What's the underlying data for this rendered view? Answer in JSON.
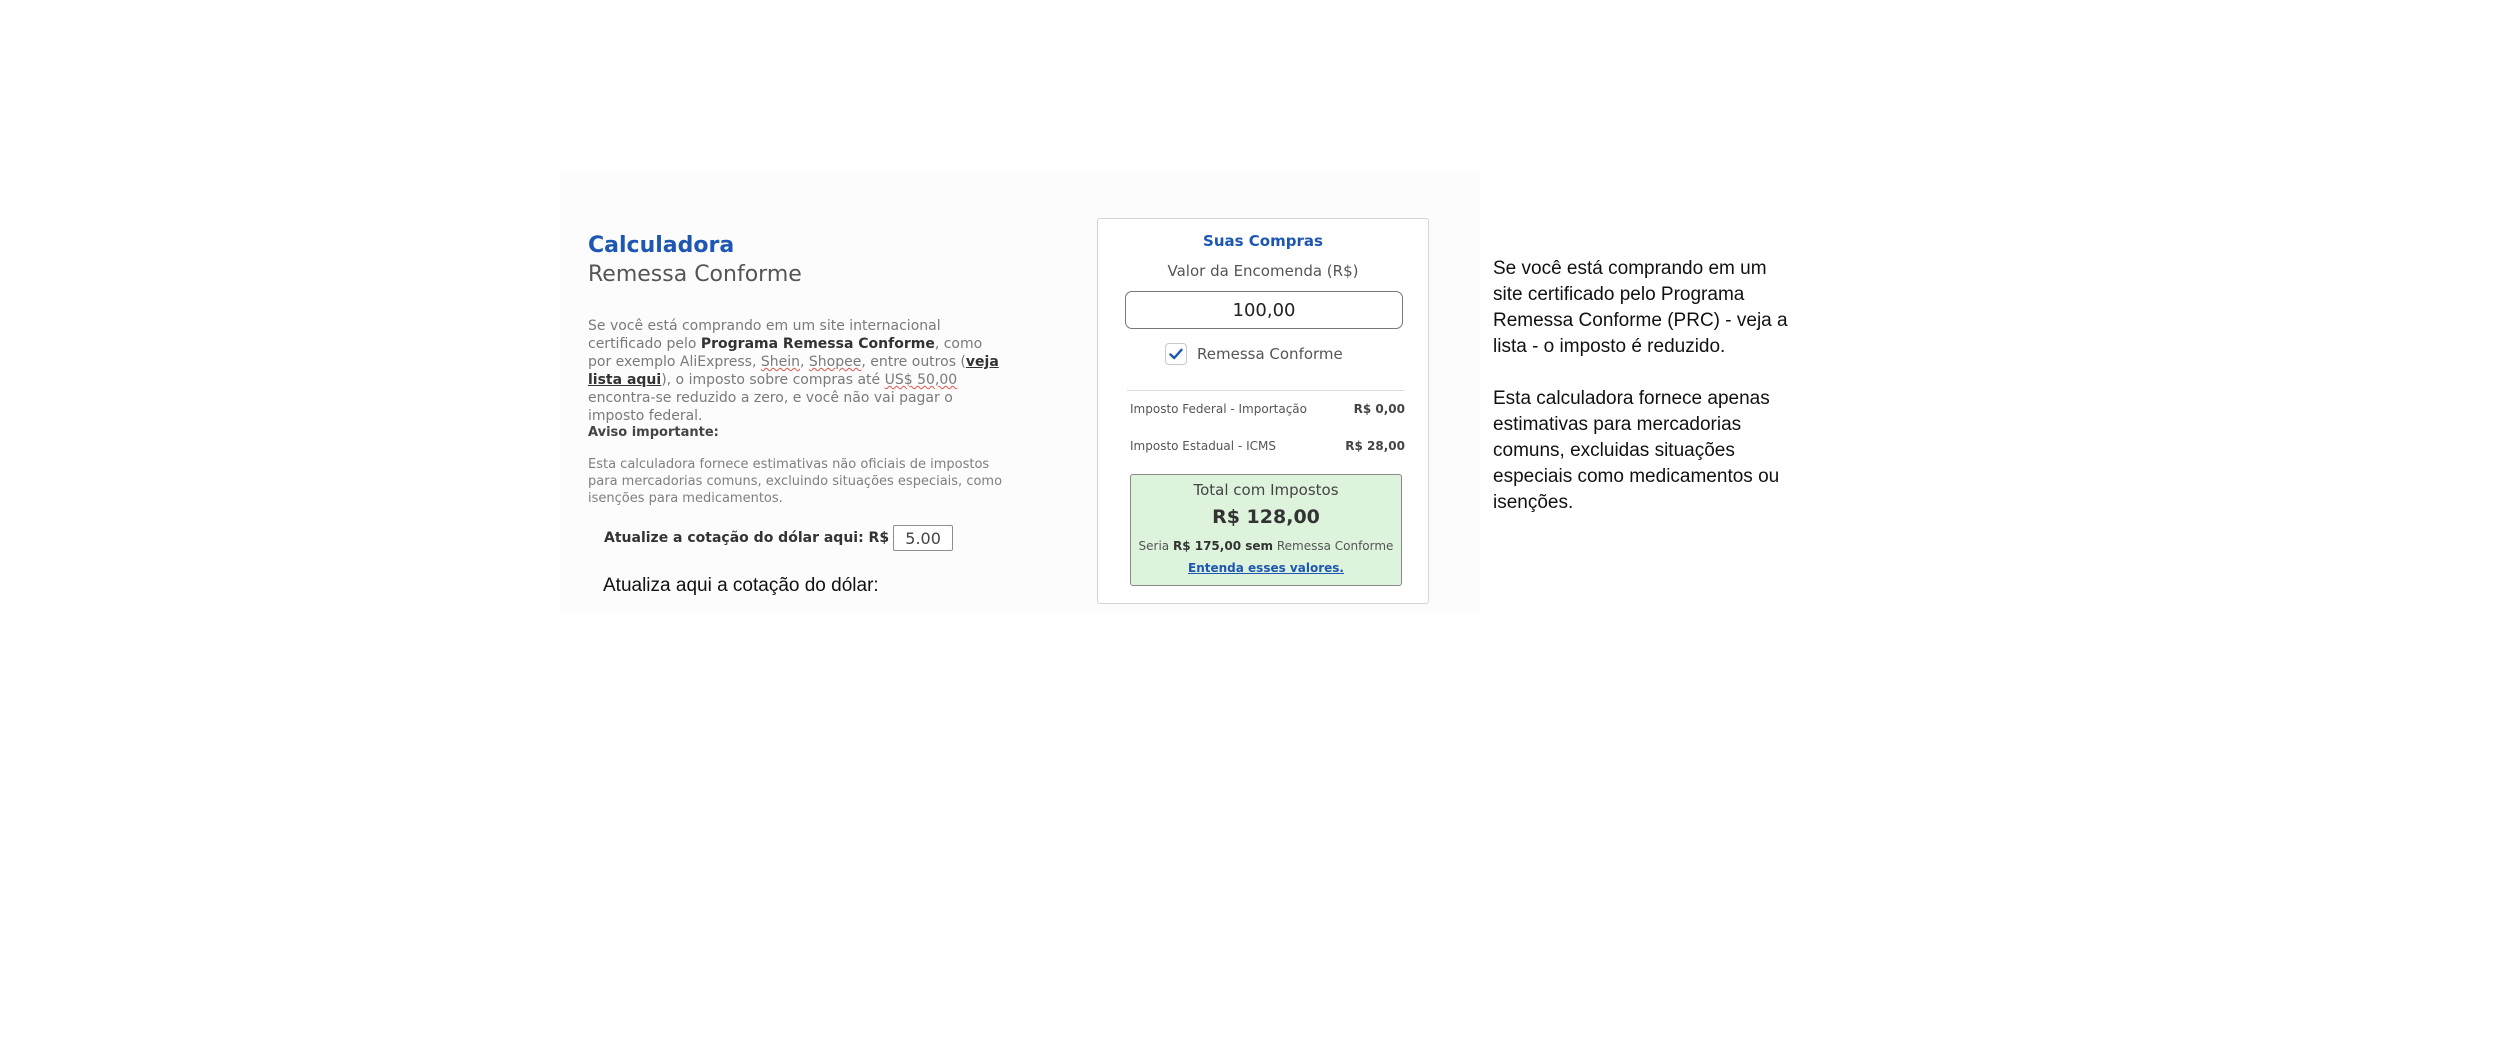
{
  "left": {
    "title": "Calculadora",
    "subtitle": "Remessa Conforme",
    "intro": {
      "p1": "Se você está comprando em um site internacional certificado pelo ",
      "program_bold": "Programa Remessa Conforme",
      "p2": ", como por exemplo AliExpress, ",
      "shein": "Shein",
      "sep1": ", ",
      "shopee": "Shopee",
      "p3": ", entre outros (",
      "link": "veja lista aqui",
      "p4": "), o imposto sobre compras até ",
      "usd": "US$ 50,00",
      "p5": " encontra-se reduzido a zero, e você não vai pagar o imposto federal."
    },
    "notice_heading": "Aviso importante:",
    "notice_text": "Esta calculadora fornece estimativas não oficiais de impostos para mercadorias comuns, excluindo situações especiais, como isenções para medicamentos.",
    "rate_label": "Atualize a cotação do dólar aqui: R$",
    "rate_value": "5.00",
    "rate_caption": "Atualiza aqui a cotação do dólar:"
  },
  "card": {
    "title": "Suas Compras",
    "value_label": "Valor da Encomenda (R$)",
    "value": "100,00",
    "checkbox_label": "Remessa Conforme",
    "checkbox_checked": true,
    "taxes": [
      {
        "label": "Imposto Federal - Importação",
        "value": "R$ 0,00"
      },
      {
        "label": "Imposto Estadual - ICMS",
        "value": "R$ 28,00"
      }
    ],
    "total_label": "Total com Impostos",
    "total_value": "R$ 128,00",
    "note_prefix": "Seria ",
    "note_bold": "R$ 175,00 sem",
    "note_suffix": " Remessa Conforme",
    "link": "Entenda esses valores."
  },
  "side": {
    "p1": "Se você está comprando em um site certificado pelo Programa Remessa Conforme (PRC) - veja a lista - o imposto é reduzido.",
    "p2": "Esta calculadora fornece  apenas estimativas para mercadorias comuns, excluidas situações especiais como medicamentos ou isenções."
  },
  "colors": {
    "accent": "#1e56b3",
    "total_bg": "#ddf3dc"
  },
  "icons": {
    "checkbox": "check-icon"
  }
}
